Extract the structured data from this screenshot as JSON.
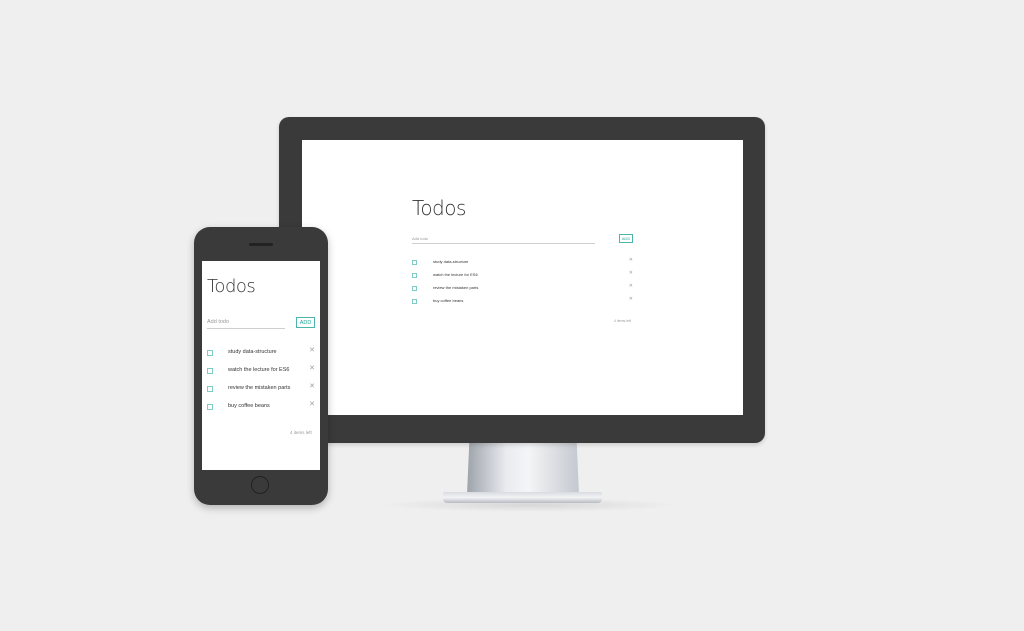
{
  "app": {
    "title": "Todos",
    "input_placeholder": "Add todo",
    "add_label": "ADD",
    "todos": [
      {
        "text": "study data-structure",
        "done": false
      },
      {
        "text": "watch the lecture for ES6",
        "done": false
      },
      {
        "text": "review the mistaken parts",
        "done": false
      },
      {
        "text": "buy coffee beans",
        "done": false
      }
    ],
    "items_left": "4 items left"
  },
  "icons": {
    "delete": "close-icon",
    "checkbox": "checkbox-icon"
  },
  "colors": {
    "background": "#efefef",
    "device_frame": "#3a3a3a",
    "accent": "#4db6ac",
    "text": "#333333",
    "muted": "#999999"
  }
}
